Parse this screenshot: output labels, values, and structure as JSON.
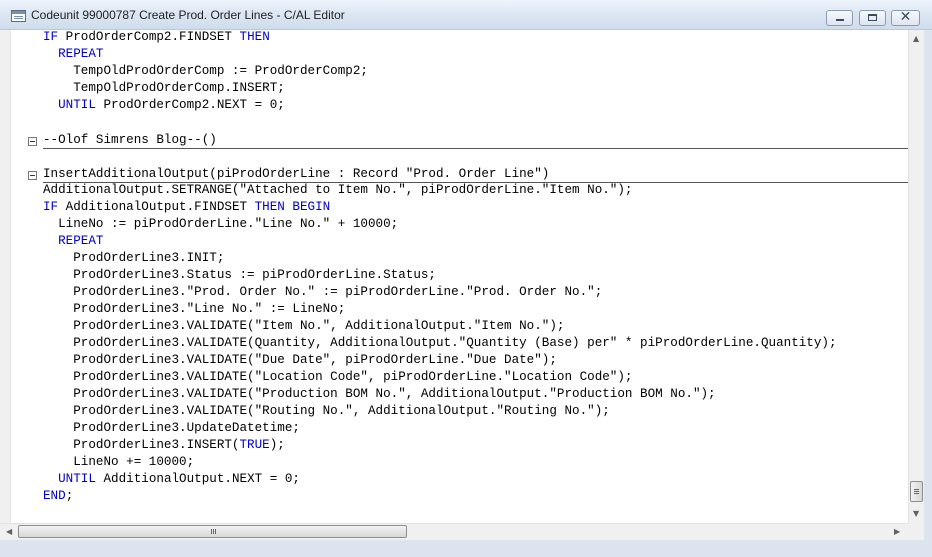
{
  "window": {
    "title": "Codeunit 99000787 Create Prod. Order Lines - C/AL Editor",
    "min_icon": "minimize-icon",
    "max_icon": "maximize-icon",
    "close_glyph": "✕"
  },
  "code": {
    "l1": [
      {
        "t": "IF",
        "k": true
      },
      {
        "t": " ProdOrderComp2.FINDSET "
      },
      {
        "t": "THEN",
        "k": true
      }
    ],
    "l2": [
      {
        "t": "  "
      },
      {
        "t": "REPEAT",
        "k": true
      }
    ],
    "l3": [
      {
        "t": "    TempOldProdOrderComp := ProdOrderComp2;"
      }
    ],
    "l4": [
      {
        "t": "    TempOldProdOrderComp.INSERT;"
      }
    ],
    "l5": [
      {
        "t": "  "
      },
      {
        "t": "UNTIL",
        "k": true
      },
      {
        "t": " ProdOrderComp2.NEXT = 0;"
      }
    ],
    "l6": [
      {
        "t": "--Olof Simrens Blog--()"
      }
    ],
    "l7": [
      {
        "t": "InsertAdditionalOutput(piProdOrderLine : Record \"Prod. Order Line\")"
      }
    ],
    "l8": [
      {
        "t": "AdditionalOutput.SETRANGE(\"Attached to Item No.\", piProdOrderLine.\"Item No.\");"
      }
    ],
    "l9": [
      {
        "t": "IF",
        "k": true
      },
      {
        "t": " AdditionalOutput.FINDSET "
      },
      {
        "t": "THEN BEGIN",
        "k": true
      }
    ],
    "l10": [
      {
        "t": "  LineNo := piProdOrderLine.\"Line No.\" + 10000;"
      }
    ],
    "l11": [
      {
        "t": "  "
      },
      {
        "t": "REPEAT",
        "k": true
      }
    ],
    "l12": [
      {
        "t": "    ProdOrderLine3.INIT;"
      }
    ],
    "l13": [
      {
        "t": "    ProdOrderLine3.Status := piProdOrderLine.Status;"
      }
    ],
    "l14": [
      {
        "t": "    ProdOrderLine3.\"Prod. Order No.\" := piProdOrderLine.\"Prod. Order No.\";"
      }
    ],
    "l15": [
      {
        "t": "    ProdOrderLine3.\"Line No.\" := LineNo;"
      }
    ],
    "l16": [
      {
        "t": "    ProdOrderLine3.VALIDATE(\"Item No.\", AdditionalOutput.\"Item No.\");"
      }
    ],
    "l17": [
      {
        "t": "    ProdOrderLine3.VALIDATE(Quantity, AdditionalOutput.\"Quantity (Base) per\" * piProdOrderLine.Quantity);"
      }
    ],
    "l18": [
      {
        "t": "    ProdOrderLine3.VALIDATE(\"Due Date\", piProdOrderLine.\"Due Date\");"
      }
    ],
    "l19": [
      {
        "t": "    ProdOrderLine3.VALIDATE(\"Location Code\", piProdOrderLine.\"Location Code\");"
      }
    ],
    "l20": [
      {
        "t": "    ProdOrderLine3.VALIDATE(\"Production BOM No.\", AdditionalOutput.\"Production BOM No.\");"
      }
    ],
    "l21": [
      {
        "t": "    ProdOrderLine3.VALIDATE(\"Routing No.\", AdditionalOutput.\"Routing No.\");"
      }
    ],
    "l22": [
      {
        "t": "    ProdOrderLine3.UpdateDatetime;"
      }
    ],
    "l23": [
      {
        "t": "    ProdOrderLine3.INSERT("
      },
      {
        "t": "TRUE",
        "k": true
      },
      {
        "t": ");"
      }
    ],
    "l24": [
      {
        "t": "    LineNo += 10000;"
      }
    ],
    "l25": [
      {
        "t": "  "
      },
      {
        "t": "UNTIL",
        "k": true
      },
      {
        "t": " AdditionalOutput.NEXT = 0;"
      }
    ],
    "l26": [
      {
        "t": "END",
        "k": true
      },
      {
        "t": ";"
      }
    ]
  },
  "colors": {
    "keyword": "#0000c8",
    "text": "#000000"
  },
  "icons": [
    "app-icon",
    "fold-minus-icon",
    "scroll-up-icon",
    "scroll-down-icon",
    "scroll-left-icon",
    "scroll-right-icon"
  ]
}
